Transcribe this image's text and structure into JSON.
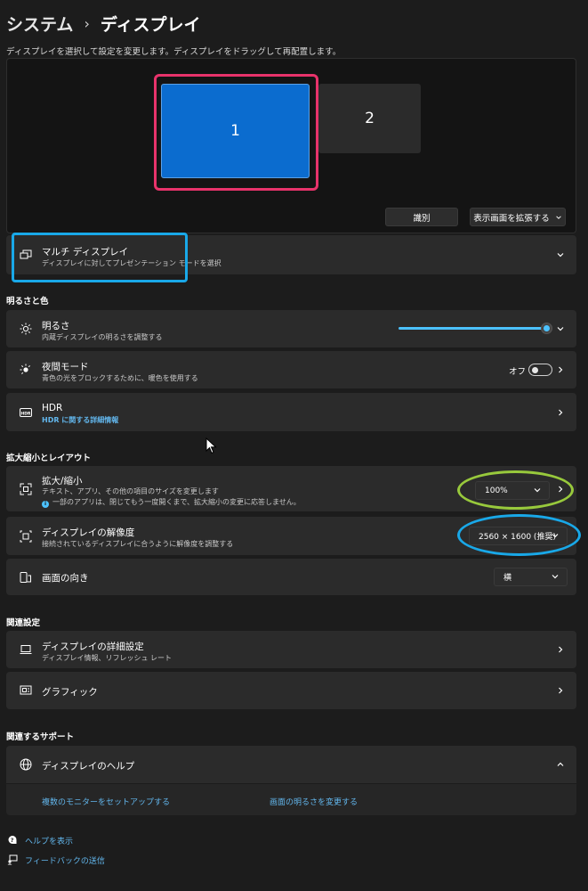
{
  "breadcrumb": {
    "parent": "システム",
    "separator": "›",
    "current": "ディスプレイ"
  },
  "subtitle": "ディスプレイを選択して設定を変更します。ディスプレイをドラッグして再配置します。",
  "display_panel": {
    "monitor_1": "1",
    "monitor_2": "2",
    "identify_label": "識別",
    "extend_label": "表示画面を拡張する"
  },
  "multi_display": {
    "title": "マルチ ディスプレイ",
    "desc": "ディスプレイに対してプレゼンテーション モードを選択"
  },
  "brightness_section": {
    "heading": "明るさと色",
    "brightness": {
      "title": "明るさ",
      "desc": "内蔵ディスプレイの明るさを調整する",
      "value": 1.0
    },
    "night_mode": {
      "title": "夜間モード",
      "desc": "青色の光をブロックするために、暖色を使用する",
      "state": "オフ"
    },
    "hdr": {
      "title": "HDR",
      "link": "HDR に関する詳細情報"
    }
  },
  "scale_section": {
    "heading": "拡大縮小とレイアウト",
    "scale": {
      "title": "拡大/縮小",
      "desc": "テキスト、アプリ、その他の項目のサイズを変更します",
      "note": "一部のアプリは、閉じてもう一度開くまで、拡大縮小の変更に応答しません。",
      "value": "100%"
    },
    "resolution": {
      "title": "ディスプレイの解像度",
      "desc": "接続されているディスプレイに合うように解像度を調整する",
      "value": "2560 × 1600 (推奨)"
    },
    "orientation": {
      "title": "画面の向き",
      "value": "横"
    }
  },
  "related_section": {
    "heading": "関連設定",
    "advanced": {
      "title": "ディスプレイの詳細設定",
      "desc": "ディスプレイ情報、リフレッシュ レート"
    },
    "graphics": {
      "title": "グラフィック"
    }
  },
  "support_section": {
    "heading": "関連するサポート",
    "help": {
      "title": "ディスプレイのヘルプ"
    },
    "links": [
      "複数のモニターをセットアップする",
      "画面の明るさを変更する"
    ]
  },
  "footer": {
    "help": "ヘルプを表示",
    "feedback": "フィードバックの送信"
  },
  "colors": {
    "accent": "#4cc2ff",
    "monitor_selected": "#0b6ccf",
    "highlight_pink": "#e8336b",
    "highlight_blue": "#19a8e8",
    "highlight_green": "#98c93c"
  }
}
